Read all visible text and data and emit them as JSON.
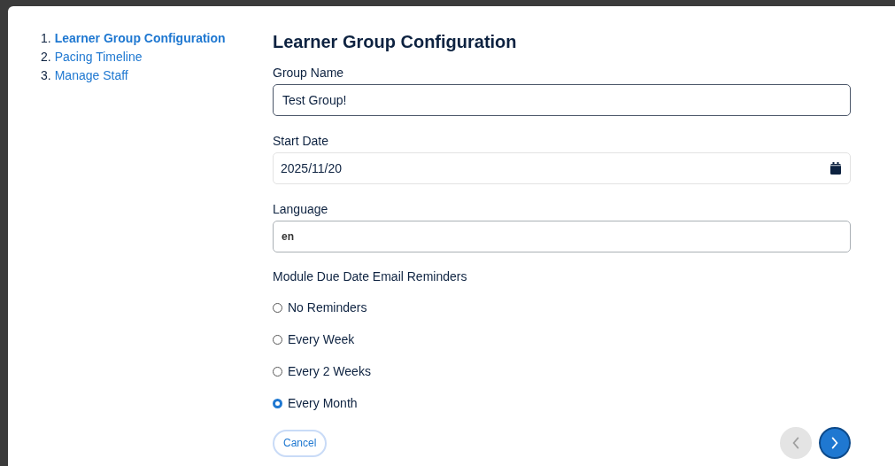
{
  "steps": [
    {
      "number": "1.",
      "label": "Learner Group Configuration",
      "selected": true
    },
    {
      "number": "2.",
      "label": "Pacing Timeline",
      "selected": false
    },
    {
      "number": "3.",
      "label": "Manage Staff",
      "selected": false
    }
  ],
  "title": "Learner Group Configuration",
  "fields": [
    {
      "kind": "text",
      "label": "Group Name",
      "value": "Test Group!"
    },
    {
      "kind": "date",
      "label": "Start Date",
      "value": "2025/11/20"
    },
    {
      "kind": "select",
      "label": "Language",
      "value": "en"
    }
  ],
  "reminders": {
    "label": "Module Due Date Email Reminders",
    "options": [
      {
        "label": "No Reminders",
        "selected": false
      },
      {
        "label": "Every Week",
        "selected": false
      },
      {
        "label": "Every 2 Weeks",
        "selected": false
      },
      {
        "label": "Every Month",
        "selected": true
      }
    ]
  },
  "footer": {
    "cancel": "Cancel",
    "previous_disabled": true,
    "next_disabled": false
  }
}
